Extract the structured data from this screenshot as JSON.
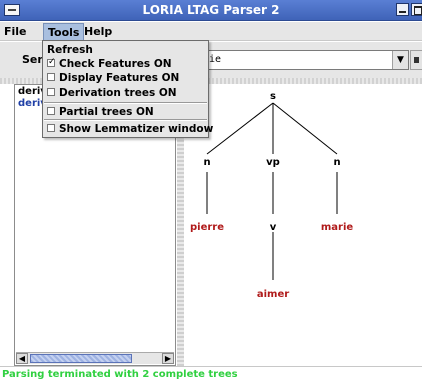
{
  "window": {
    "title": "LORIA LTAG Parser 2"
  },
  "menubar": {
    "file": "File",
    "tools": "Tools",
    "help": "Help"
  },
  "toolbar": {
    "sentence_label": "Sen",
    "sentence_value": "ie"
  },
  "left_panel": {
    "items": [
      "deriv",
      "deriv"
    ]
  },
  "tools_menu": {
    "items": [
      {
        "label": "Refresh",
        "has_checkbox": false,
        "checked": false
      },
      {
        "label": "Check Features ON",
        "has_checkbox": true,
        "checked": true
      },
      {
        "label": "Display Features ON",
        "has_checkbox": true,
        "checked": false
      },
      {
        "label": "Derivation trees ON",
        "has_checkbox": true,
        "checked": false
      },
      {
        "label": "Partial trees ON",
        "has_checkbox": true,
        "checked": false
      },
      {
        "label": "Show Lemmatizer window",
        "has_checkbox": true,
        "checked": false
      }
    ]
  },
  "tree": {
    "nodes": {
      "s": "s",
      "n1": "n",
      "vp": "vp",
      "n2": "n",
      "pierre": "pierre",
      "v": "v",
      "marie": "marie",
      "aimer": "aimer"
    },
    "colors": {
      "category": "#000000",
      "word": "#b01a1a"
    }
  },
  "status": {
    "text": "Parsing terminated with 2 complete trees",
    "color": "#30d040"
  }
}
